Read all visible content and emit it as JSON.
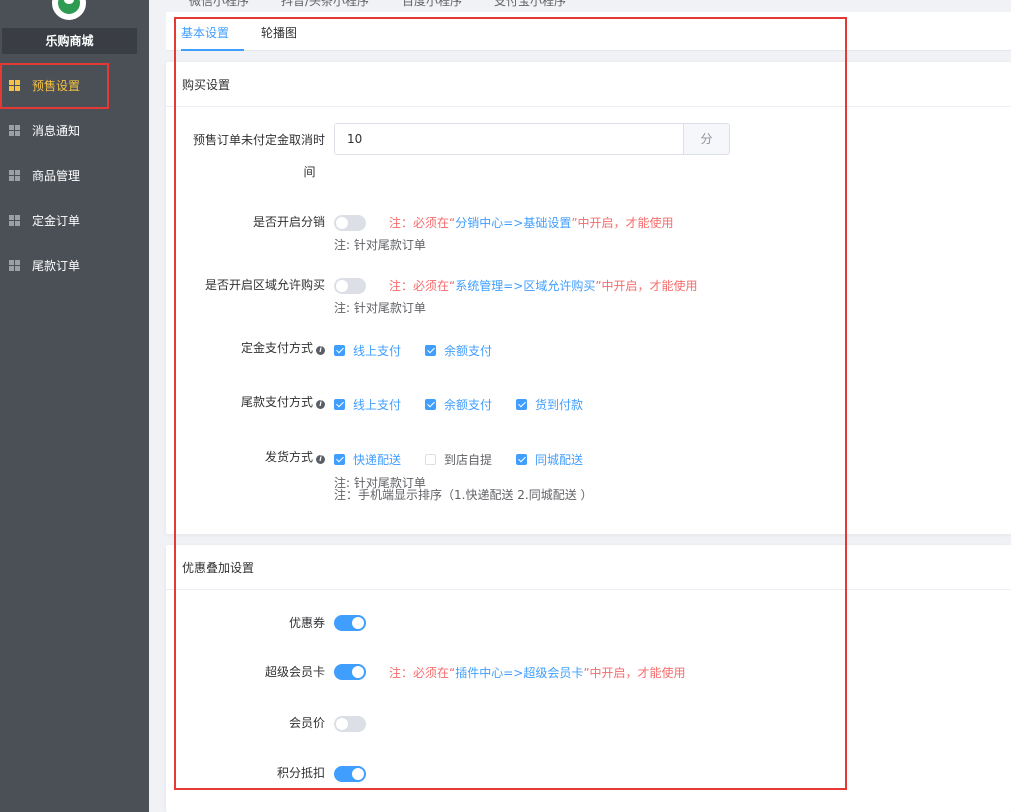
{
  "sidebar": {
    "store_name": "乐购商城",
    "items": [
      {
        "label": "预售设置",
        "active": true
      },
      {
        "label": "消息通知",
        "active": false
      },
      {
        "label": "商品管理",
        "active": false
      },
      {
        "label": "定金订单",
        "active": false
      },
      {
        "label": "尾款订单",
        "active": false
      }
    ]
  },
  "top_tabs": [
    "微信小程序",
    "抖音/头条小程序",
    "百度小程序",
    "支付宝小程序"
  ],
  "sub_tabs": [
    {
      "label": "基本设置",
      "active": true
    },
    {
      "label": "轮播图",
      "active": false
    }
  ],
  "purchase": {
    "title": "购买设置",
    "cancel_time": {
      "label_line1": "预售订单未付定金取消时",
      "label_line2": "间",
      "value": "10",
      "unit": "分"
    },
    "distribution": {
      "label": "是否开启分销",
      "enabled": false,
      "note_prefix": "注：必须在“",
      "note_link": "分销中心=>基础设置",
      "note_suffix": "”中开启，才能使用",
      "sub_note": "注: 针对尾款订单"
    },
    "region": {
      "label": "是否开启区域允许购买",
      "enabled": false,
      "note_prefix": "注：必须在“",
      "note_link": "系统管理=>区域允许购买",
      "note_suffix": "”中开启，才能使用",
      "sub_note": "注: 针对尾款订单"
    },
    "deposit_pay": {
      "label": "定金支付方式",
      "options": [
        {
          "label": "线上支付",
          "checked": true
        },
        {
          "label": "余额支付",
          "checked": true
        }
      ]
    },
    "final_pay": {
      "label": "尾款支付方式",
      "options": [
        {
          "label": "线上支付",
          "checked": true
        },
        {
          "label": "余额支付",
          "checked": true
        },
        {
          "label": "货到付款",
          "checked": true
        }
      ]
    },
    "delivery": {
      "label": "发货方式",
      "options": [
        {
          "label": "快递配送",
          "checked": true
        },
        {
          "label": "到店自提",
          "checked": false
        },
        {
          "label": "同城配送",
          "checked": true
        }
      ],
      "note1": "注: 针对尾款订单",
      "note2": "注：手机端显示排序（1.快递配送 2.同城配送 ）"
    }
  },
  "discount": {
    "title": "优惠叠加设置",
    "coupon": {
      "label": "优惠券",
      "enabled": true
    },
    "svip": {
      "label": "超级会员卡",
      "enabled": true,
      "note_prefix": "注：必须在“",
      "note_link": "插件中心=>超级会员卡",
      "note_suffix": "”中开启，才能使用"
    },
    "member_price": {
      "label": "会员价",
      "enabled": false
    },
    "points": {
      "label": "积分抵扣",
      "enabled": true
    }
  },
  "colors": {
    "sidebar_bg": "#4b5057",
    "active_menu": "#f5c243",
    "primary": "#409eff",
    "danger": "#f56c6c",
    "highlight_box": "#e53935"
  }
}
